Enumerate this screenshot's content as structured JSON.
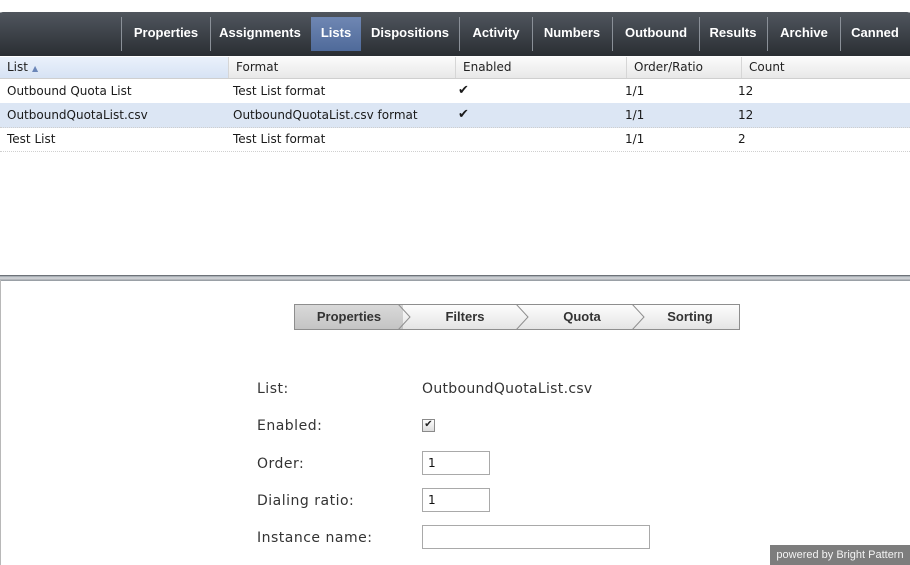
{
  "tabs": [
    {
      "label": "Properties",
      "active": false
    },
    {
      "label": "Assignments",
      "active": false
    },
    {
      "label": "Lists",
      "active": true
    },
    {
      "label": "Dispositions",
      "active": false
    },
    {
      "label": "Activity",
      "active": false
    },
    {
      "label": "Numbers",
      "active": false
    },
    {
      "label": "Outbound",
      "active": false
    },
    {
      "label": "Results",
      "active": false
    },
    {
      "label": "Archive",
      "active": false
    },
    {
      "label": "Canned",
      "active": false
    }
  ],
  "grid": {
    "columns": [
      "List",
      "Format",
      "Enabled",
      "Order/Ratio",
      "Count"
    ],
    "sort": {
      "column": "List",
      "direction": "ascending"
    },
    "rows": [
      {
        "list": "Outbound Quota List",
        "format": "Test List format",
        "enabled": "✔",
        "order_ratio": "1/1",
        "count": "12",
        "selected": false
      },
      {
        "list": "OutboundQuotaList.csv",
        "format": "OutboundQuotaList.csv format",
        "enabled": "✔",
        "order_ratio": "1/1",
        "count": "12",
        "selected": true
      },
      {
        "list": "Test List",
        "format": "Test List format",
        "enabled": "",
        "order_ratio": "1/1",
        "count": "2",
        "selected": false
      }
    ]
  },
  "wizard": {
    "steps": [
      "Properties",
      "Filters",
      "Quota",
      "Sorting"
    ],
    "active_step": "Properties"
  },
  "form": {
    "list_label": "List:",
    "list_value": "OutboundQuotaList.csv",
    "enabled_label": "Enabled:",
    "enabled_checked": true,
    "order_label": "Order:",
    "order_value": "1",
    "dialing_ratio_label": "Dialing ratio:",
    "dialing_ratio_value": "1",
    "instance_name_label": "Instance name:",
    "instance_name_value": ""
  },
  "footer": {
    "powered_by": "powered by Bright Pattern"
  },
  "colors": {
    "active_tab": "#5a73a4",
    "selected_row": "#dce6f4",
    "tab_bar": "#2e3238"
  }
}
